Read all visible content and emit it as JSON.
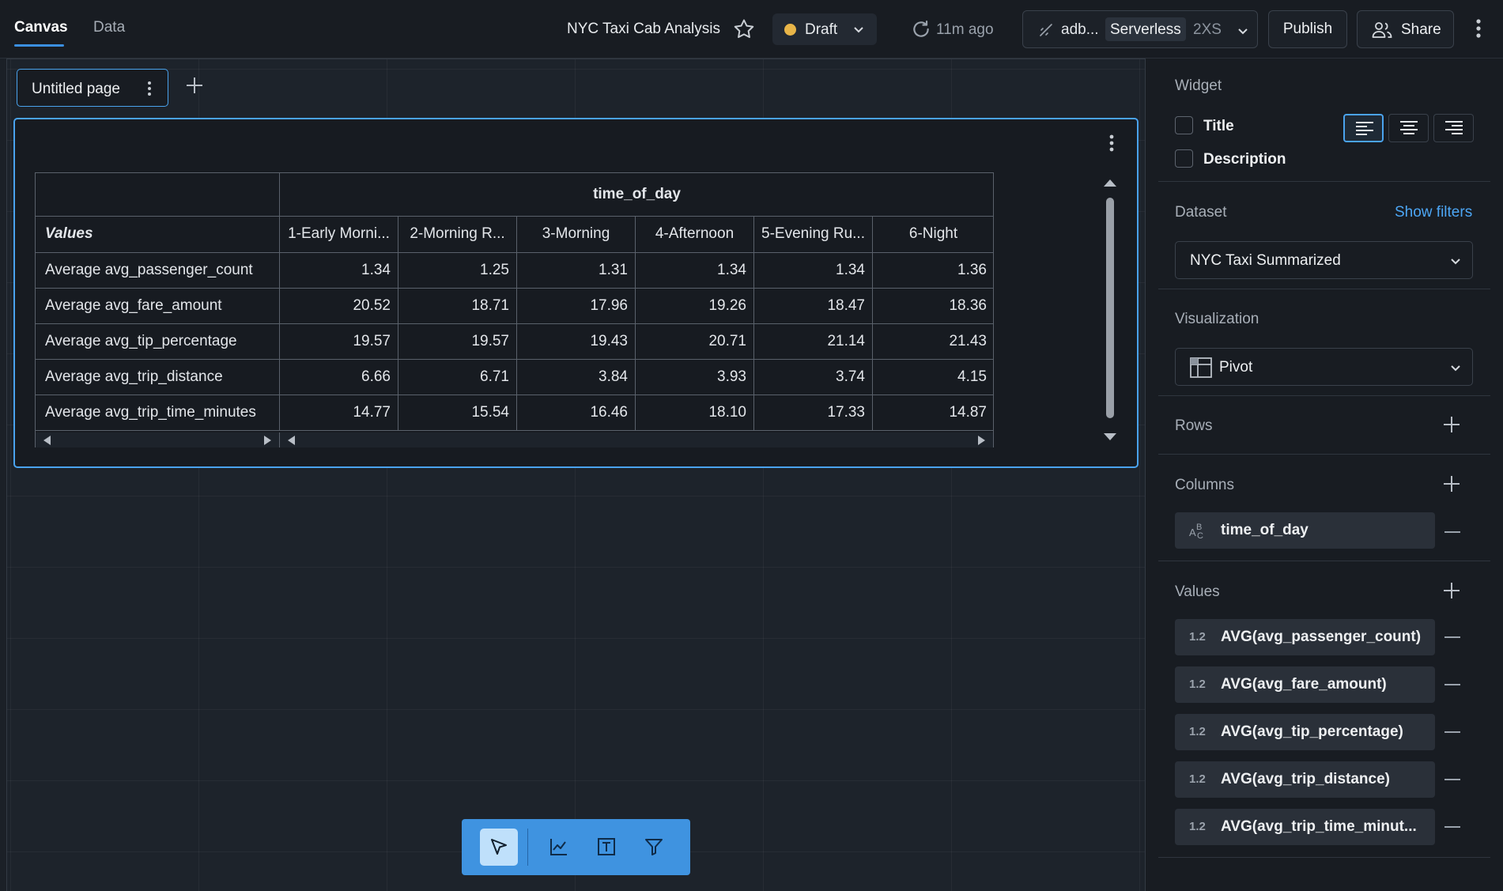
{
  "header": {
    "tabs": [
      {
        "label": "Canvas"
      },
      {
        "label": "Data"
      }
    ],
    "dashboard_title": "NYC Taxi Cab Analysis",
    "status": "Draft",
    "status_color": "#e8b548",
    "last_refresh": "11m ago",
    "warehouse": {
      "name": "adb...",
      "type": "Serverless",
      "size": "2XS"
    },
    "publish_label": "Publish",
    "share_label": "Share"
  },
  "canvas": {
    "page_tab_label": "Untitled page",
    "pivot": {
      "column_field": "time_of_day",
      "values_header": "Values",
      "columns": [
        "1-Early Morni...",
        "2-Morning R...",
        "3-Morning",
        "4-Afternoon",
        "5-Evening Ru...",
        "6-Night"
      ],
      "rows": [
        {
          "label": "Average avg_passenger_count",
          "values": [
            "1.34",
            "1.25",
            "1.31",
            "1.34",
            "1.34",
            "1.36"
          ]
        },
        {
          "label": "Average avg_fare_amount",
          "values": [
            "20.52",
            "18.71",
            "17.96",
            "19.26",
            "18.47",
            "18.36"
          ]
        },
        {
          "label": "Average avg_tip_percentage",
          "values": [
            "19.57",
            "19.57",
            "19.43",
            "20.71",
            "21.14",
            "21.43"
          ]
        },
        {
          "label": "Average avg_trip_distance",
          "values": [
            "6.66",
            "6.71",
            "3.84",
            "3.93",
            "3.74",
            "4.15"
          ]
        },
        {
          "label": "Average avg_trip_time_minutes",
          "values": [
            "14.77",
            "15.54",
            "16.46",
            "18.10",
            "17.33",
            "14.87"
          ]
        }
      ]
    },
    "toolbar_tools": [
      "select-tool",
      "chart-tool",
      "text-tool",
      "filter-tool"
    ],
    "accent_color": "#4aa3ee"
  },
  "panel": {
    "widget_title": "Widget",
    "title_option": "Title",
    "description_option": "Description",
    "dataset_title": "Dataset",
    "show_filters": "Show filters",
    "dataset_value": "NYC Taxi Summarized",
    "visualization_title": "Visualization",
    "visualization_value": "Pivot",
    "rows_title": "Rows",
    "columns_title": "Columns",
    "column_fields": [
      {
        "type": "ABC",
        "name": "time_of_day"
      }
    ],
    "values_title": "Values",
    "value_fields": [
      {
        "type": "1.2",
        "name": "AVG(avg_passenger_count)"
      },
      {
        "type": "1.2",
        "name": "AVG(avg_fare_amount)"
      },
      {
        "type": "1.2",
        "name": "AVG(avg_tip_percentage)"
      },
      {
        "type": "1.2",
        "name": "AVG(avg_trip_distance)"
      },
      {
        "type": "1.2",
        "name": "AVG(avg_trip_time_minut..."
      }
    ]
  }
}
